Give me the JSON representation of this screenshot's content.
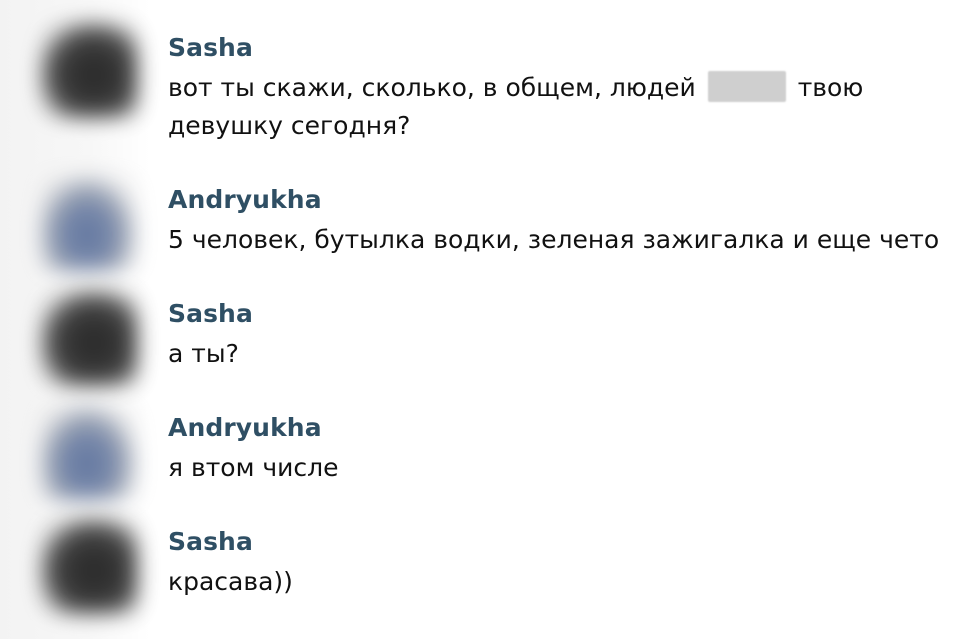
{
  "messages": [
    {
      "author": "Sasha",
      "text_before": "вот ты скажи, сколько, в общем, людей",
      "text_after": "твою девушку сегодня?"
    },
    {
      "author": "Andryukha",
      "text": "5 человек, бутылка водки, зеленая зажигалка и еще чето"
    },
    {
      "author": "Sasha",
      "text": "а ты?"
    },
    {
      "author": "Andryukha",
      "text": "я втом числе"
    },
    {
      "author": "Sasha",
      "text": "красава))"
    }
  ]
}
